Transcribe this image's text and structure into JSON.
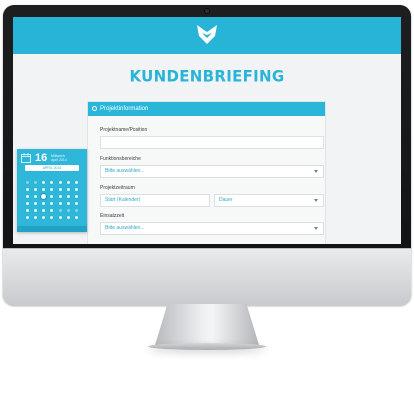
{
  "app": {
    "title": "KUNDENBRIEFING",
    "brand_color": "#27b4d6",
    "logo": "fox-logo-icon"
  },
  "section": {
    "title": "Projektinformation",
    "icon": "circle-arrow-icon"
  },
  "fields": {
    "projektname_label": "Projektname/Position",
    "projektname_value": "",
    "funktionsbereiche_label": "Funktionsbereiche",
    "funktionsbereiche_value": "Bitte auswählen...",
    "projektzeitraum_label": "Projektzeitraum",
    "start_value": "Start (Kalender)",
    "dauer_value": "Dauer",
    "einsatzzeit_label": "Einsatzzeit",
    "einsatzzeit_value": "Bitte auswählen..."
  },
  "calendar": {
    "day": "16",
    "month_line1": "Mittwoch",
    "month_line2": "April 2014",
    "month_bar": "APRIL 2014",
    "icon": "calendar-icon"
  }
}
